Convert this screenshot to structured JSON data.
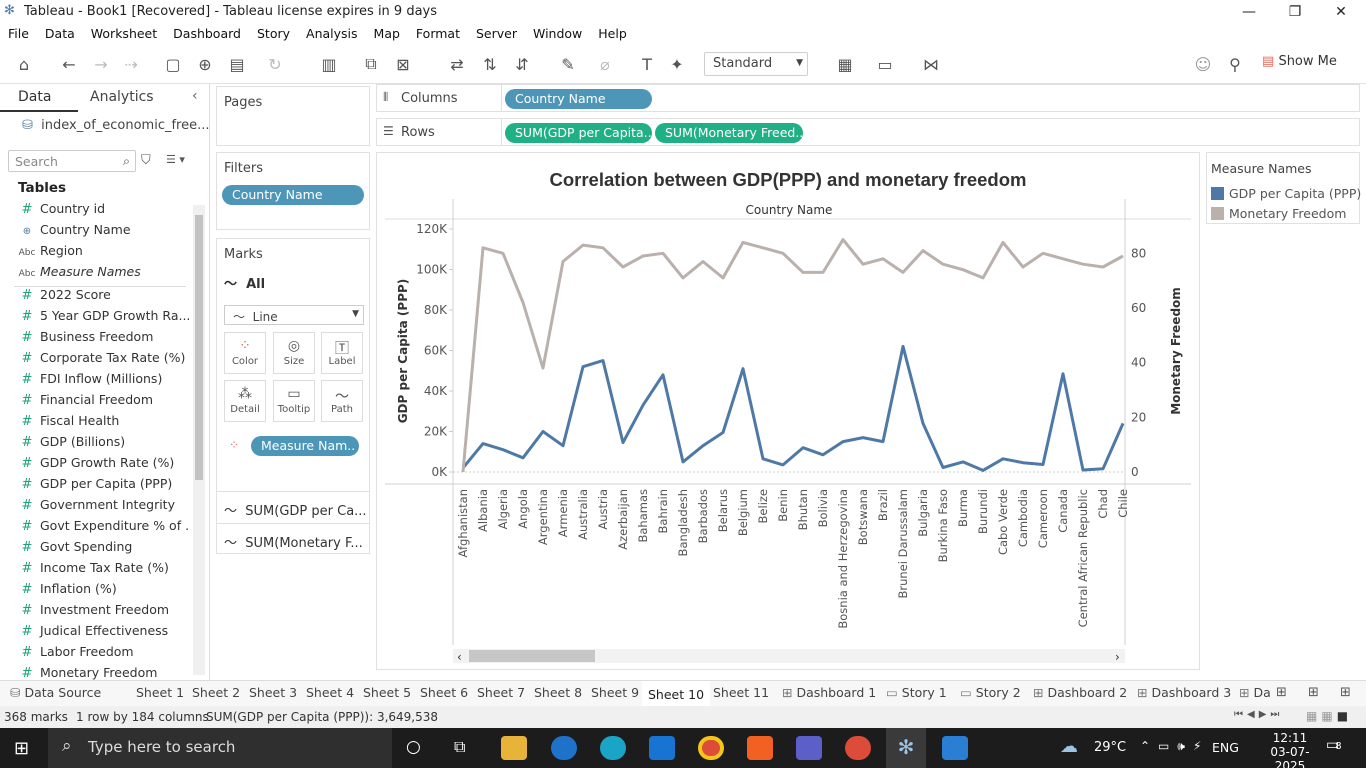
{
  "window": {
    "title": "Tableau - Book1 [Recovered] - Tableau license expires in 9 days"
  },
  "menu": [
    "File",
    "Data",
    "Worksheet",
    "Dashboard",
    "Story",
    "Analysis",
    "Map",
    "Format",
    "Server",
    "Window",
    "Help"
  ],
  "toolbar": {
    "fit_value": "Standard",
    "show_me": "Show Me"
  },
  "left": {
    "tab_data": "Data",
    "tab_analytics": "Analytics",
    "datasource": "index_of_economic_free...",
    "search_placeholder": "Search",
    "tables_label": "Tables",
    "fields": [
      {
        "type": "#",
        "name": "Country id"
      },
      {
        "type": "globe",
        "name": "Country Name"
      },
      {
        "type": "Abc",
        "name": "Region"
      },
      {
        "type": "Abc",
        "name": "Measure Names"
      },
      {
        "type": "#",
        "name": "2022 Score"
      },
      {
        "type": "#",
        "name": "5 Year GDP Growth Ra..."
      },
      {
        "type": "#",
        "name": "Business Freedom"
      },
      {
        "type": "#",
        "name": "Corporate Tax Rate (%)"
      },
      {
        "type": "#",
        "name": "FDI Inflow (Millions)"
      },
      {
        "type": "#",
        "name": "Financial Freedom"
      },
      {
        "type": "#",
        "name": "Fiscal Health"
      },
      {
        "type": "#",
        "name": "GDP (Billions)"
      },
      {
        "type": "#",
        "name": "GDP Growth Rate (%)"
      },
      {
        "type": "#",
        "name": "GDP per Capita (PPP)"
      },
      {
        "type": "#",
        "name": "Government Integrity"
      },
      {
        "type": "#",
        "name": "Govt Expenditure % of ..."
      },
      {
        "type": "#",
        "name": "Govt Spending"
      },
      {
        "type": "#",
        "name": "Income Tax Rate (%)"
      },
      {
        "type": "#",
        "name": "Inflation (%)"
      },
      {
        "type": "#",
        "name": "Investment Freedom"
      },
      {
        "type": "#",
        "name": "Judical Effectiveness"
      },
      {
        "type": "#",
        "name": "Labor Freedom"
      },
      {
        "type": "#",
        "name": "Monetary Freedom"
      }
    ]
  },
  "pages": {
    "title": "Pages"
  },
  "filters": {
    "title": "Filters",
    "pill": "Country Name"
  },
  "marks": {
    "title": "Marks",
    "all": "All",
    "type": "Line",
    "buttons": [
      "Color",
      "Size",
      "Label",
      "Detail",
      "Tooltip",
      "Path"
    ],
    "measure_pill": "Measure Nam..",
    "sub1": "SUM(GDP per Ca...",
    "sub2": "SUM(Monetary F..."
  },
  "shelves": {
    "columns_label": "Columns",
    "columns_pill": "Country Name",
    "rows_label": "Rows",
    "rows_pill1": "SUM(GDP per Capita..",
    "rows_pill2": "SUM(Monetary Freed.."
  },
  "legend": {
    "title": "Measure Names",
    "colors": [
      "#4e79a7",
      "#bab0ac"
    ]
  },
  "chart_data": {
    "type": "line",
    "title": "Correlation between GDP(PPP) and monetary freedom",
    "xlabel": "Country Name",
    "ylabel": "GDP per Capita (PPP)",
    "y2label": "Monetary Freedom",
    "ylim": [
      0,
      120000
    ],
    "y2lim": [
      0,
      80
    ],
    "yticks": [
      "0K",
      "20K",
      "40K",
      "60K",
      "80K",
      "100K",
      "120K"
    ],
    "y2ticks": [
      "0",
      "20",
      "40",
      "60",
      "80"
    ],
    "categories": [
      "Afghanistan",
      "Albania",
      "Algeria",
      "Angola",
      "Argentina",
      "Armenia",
      "Australia",
      "Austria",
      "Azerbaijan",
      "Bahamas",
      "Bahrain",
      "Bangladesh",
      "Barbados",
      "Belarus",
      "Belgium",
      "Belize",
      "Benin",
      "Bhutan",
      "Bolivia",
      "Bosnia and Herzegovina",
      "Botswana",
      "Brazil",
      "Brunei Darussalam",
      "Bulgaria",
      "Burkina Faso",
      "Burma",
      "Burundi",
      "Cabo Verde",
      "Cambodia",
      "Cameroon",
      "Canada",
      "Central African Republic",
      "Chad",
      "Chile"
    ],
    "series": [
      {
        "name": "GDP per Capita (PPP)",
        "axis": "left",
        "color": "#4e79a7",
        "values": [
          2000,
          14000,
          11000,
          7000,
          20000,
          13000,
          52000,
          55000,
          14500,
          33000,
          48000,
          5000,
          13000,
          19500,
          51000,
          6500,
          3500,
          12000,
          8500,
          15000,
          17000,
          15000,
          62000,
          24000,
          2200,
          5000,
          800,
          6500,
          4600,
          3700,
          48500,
          1000,
          1600,
          24000
        ]
      },
      {
        "name": "Monetary Freedom",
        "axis": "right",
        "color": "#bab0ac",
        "values": [
          0,
          82,
          80,
          62,
          38,
          77,
          83,
          82,
          75,
          79,
          80,
          71,
          77,
          71,
          84,
          82,
          80,
          73,
          73,
          85,
          76,
          78,
          73,
          81,
          76,
          74,
          71,
          84,
          75,
          80,
          78,
          76,
          75,
          79
        ]
      }
    ],
    "legend": "right"
  },
  "sheet_tabs": [
    "Data Source",
    "Sheet 1",
    "Sheet 2",
    "Sheet 3",
    "Sheet 4",
    "Sheet 5",
    "Sheet 6",
    "Sheet 7",
    "Sheet 8",
    "Sheet 9",
    "Sheet 10",
    "Sheet 11",
    "Dashboard 1",
    "Story 1",
    "Story 2",
    "Dashboard 2",
    "Dashboard 3",
    "Da"
  ],
  "active_tab": "Sheet 10",
  "status": {
    "marks": "368 marks",
    "dims": "1 row by 184 columns",
    "sum": "SUM(GDP per Capita (PPP)): 3,649,538"
  },
  "taskbar": {
    "search": "Type here to search",
    "temp": "29°C",
    "lang": "ENG",
    "time": "12:11",
    "date": "03-07-2025",
    "notif": "8"
  }
}
